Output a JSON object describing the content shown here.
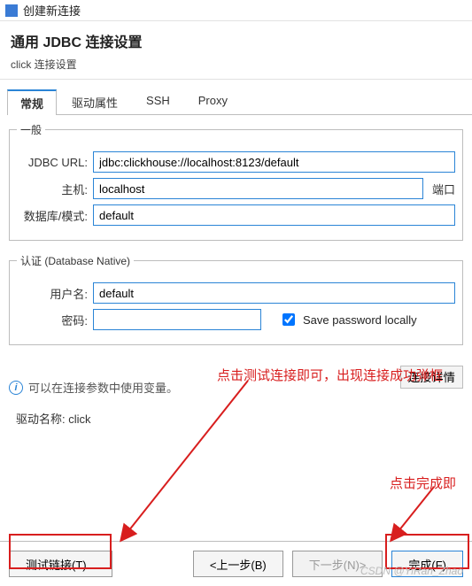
{
  "titlebar": {
    "text": "创建新连接"
  },
  "header": {
    "title": "通用 JDBC 连接设置",
    "subtitle": "click 连接设置"
  },
  "tabs": [
    "常规",
    "驱动属性",
    "SSH",
    "Proxy"
  ],
  "fieldset_general": {
    "legend": "一般",
    "jdbc_label": "JDBC URL:",
    "jdbc_value": "jdbc:clickhouse://localhost:8123/default",
    "host_label": "主机:",
    "host_value": "localhost",
    "port_label": "端口",
    "db_label": "数据库/模式:",
    "db_value": "default"
  },
  "fieldset_auth": {
    "legend": "认证 (Database Native)",
    "user_label": "用户名:",
    "user_value": "default",
    "pass_label": "密码:",
    "pass_value": "",
    "save_label": "Save password locally"
  },
  "info_text": "可以在连接参数中使用变量。",
  "details_btn": "连接详情",
  "driver_label": "驱动名称:",
  "driver_value": "click",
  "footer": {
    "test": "测试链接(T)...",
    "back": "<上一步(B)",
    "next": "下一步(N)>",
    "finish": "完成(F)"
  },
  "annotations": {
    "a1": "点击测试连接即可，出现连接成功弹框",
    "a2": "点击完成即"
  },
  "watermark": "CSDN @YiRan_Zhao"
}
